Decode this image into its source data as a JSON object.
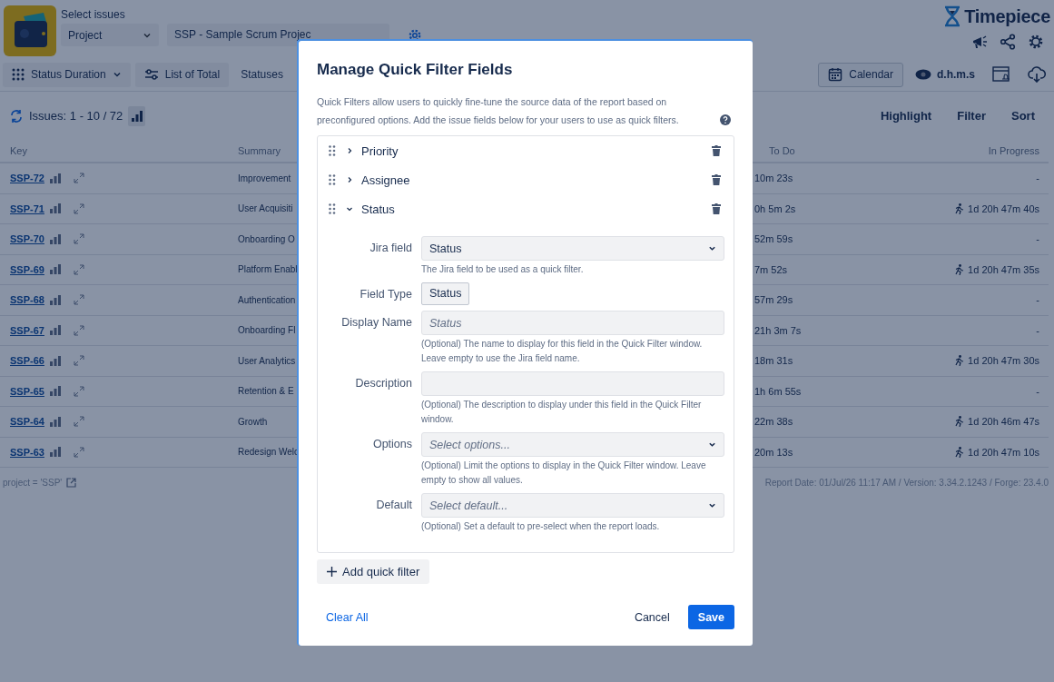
{
  "header": {
    "label": "Select issues",
    "project_type": "Project",
    "project": "SSP - Sample Scrum Projec"
  },
  "brand": "Timepiece",
  "toolbar": {
    "report": "Status Duration",
    "list": "List of Total",
    "statuses": "Statuses",
    "calendar": "Calendar",
    "format": "d.h.m.s"
  },
  "issues_count": "Issues: 1 - 10 / 72",
  "actions": [
    "Highlight",
    "Filter",
    "Sort"
  ],
  "table": {
    "columns": [
      "Key",
      "Summary",
      "To Do",
      "In Progress"
    ],
    "rows": [
      {
        "key": "SSP-72",
        "summary": "Improvement",
        "todo": "10m 23s",
        "in_progress": "-",
        "running": false
      },
      {
        "key": "SSP-71",
        "summary": "User Acquisiti",
        "todo": "0h 5m 2s",
        "in_progress": "1d 20h 47m 40s",
        "running": true
      },
      {
        "key": "SSP-70",
        "summary": "Onboarding O",
        "todo": "52m 59s",
        "in_progress": "-",
        "running": false
      },
      {
        "key": "SSP-69",
        "summary": "Platform Enabl",
        "todo": "7m 52s",
        "in_progress": "1d 20h 47m 35s",
        "running": true
      },
      {
        "key": "SSP-68",
        "summary": "Authentication",
        "todo": "57m 29s",
        "in_progress": "-",
        "running": false
      },
      {
        "key": "SSP-67",
        "summary": "Onboarding Fl",
        "todo": "21h 3m 7s",
        "in_progress": "-",
        "running": false
      },
      {
        "key": "SSP-66",
        "summary": "User Analytics",
        "todo": "18m 31s",
        "in_progress": "1d 20h 47m 30s",
        "running": true
      },
      {
        "key": "SSP-65",
        "summary": "Retention & E",
        "todo": "1h 6m 55s",
        "in_progress": "-",
        "running": false
      },
      {
        "key": "SSP-64",
        "summary": "Growth",
        "todo": "22m 38s",
        "in_progress": "1d 20h 46m 47s",
        "running": true
      },
      {
        "key": "SSP-63",
        "summary": "Redesign Welc",
        "todo": "20m 13s",
        "in_progress": "1d 20h 47m 10s",
        "running": true
      }
    ]
  },
  "footer": {
    "query": "project = 'SSP'",
    "report_info": "Report Date: 01/Jul/26 11:17 AM / Version: 3.34.2.1243 / Forge: 23.4.0"
  },
  "dialog": {
    "title": "Manage Quick Filter Fields",
    "description": "Quick Filters allow users to quickly fine-tune the source data of the report based on preconfigured options. Add the issue fields below for your users to use as quick filters.",
    "fields": [
      {
        "label": "Priority",
        "expanded": false
      },
      {
        "label": "Assignee",
        "expanded": false
      },
      {
        "label": "Status",
        "expanded": true,
        "settings": [
          {
            "label": "Jira field",
            "kind": "select",
            "value": "Status",
            "help": "The Jira field to be used as a quick filter."
          },
          {
            "label": "Field Type",
            "kind": "tag",
            "value": "Status"
          },
          {
            "label": "Display Name",
            "kind": "text",
            "placeholder": "Status",
            "help": "(Optional) The name to display for this field in the Quick Filter window. Leave empty to use the Jira field name."
          },
          {
            "label": "Description",
            "kind": "text",
            "help": "(Optional) The description to display under this field in the Quick Filter window."
          },
          {
            "label": "Options",
            "kind": "select",
            "placeholder": "Select options...",
            "help": "(Optional) Limit the options to display in the Quick Filter window. Leave empty to show all values."
          },
          {
            "label": "Default",
            "kind": "select",
            "placeholder": "Select default...",
            "help": "(Optional) Set a default to pre-select when the report loads."
          }
        ]
      }
    ],
    "add_button": "Add quick filter",
    "clear_button": "Clear All",
    "cancel_button": "Cancel",
    "save_button": "Save"
  }
}
